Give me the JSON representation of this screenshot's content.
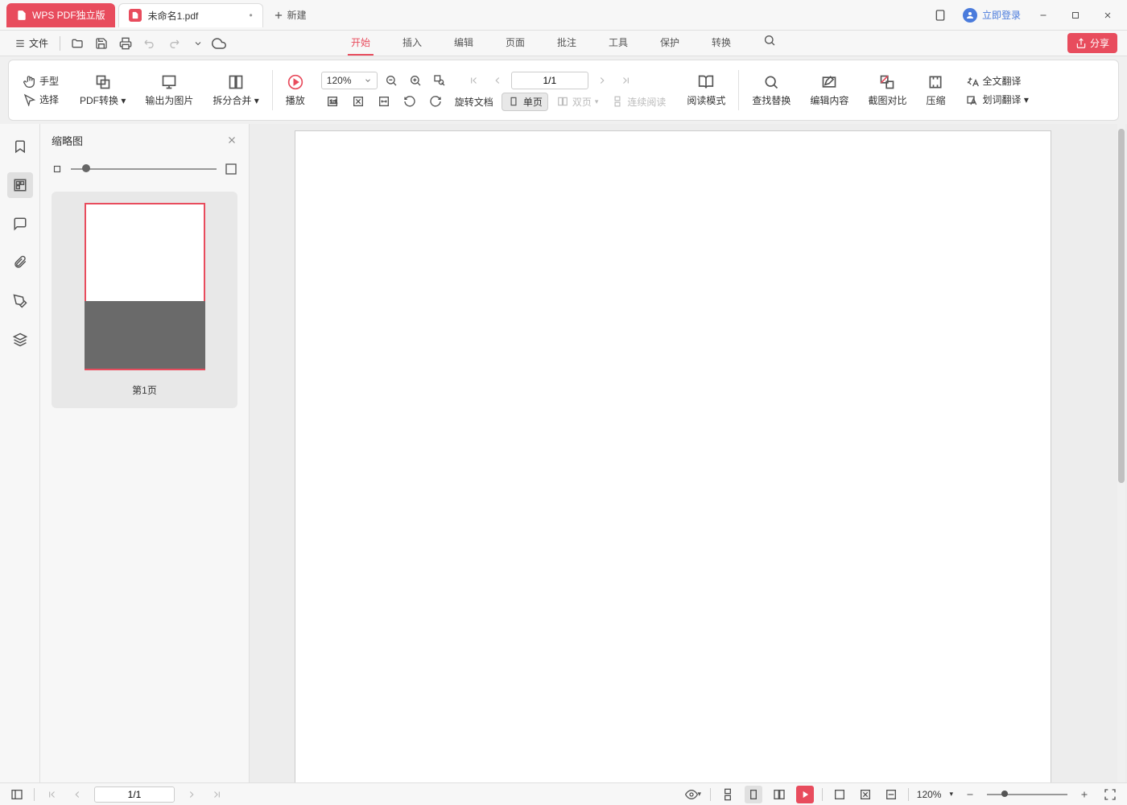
{
  "titleBar": {
    "appName": "WPS PDF独立版",
    "docName": "未命名1.pdf",
    "newTab": "新建",
    "login": "立即登录"
  },
  "quickBar": {
    "fileMenu": "文件"
  },
  "menuTabs": {
    "start": "开始",
    "insert": "插入",
    "edit": "编辑",
    "page": "页面",
    "annotate": "批注",
    "tools": "工具",
    "protect": "保护",
    "convert": "转换"
  },
  "ribbon": {
    "handTool": "手型",
    "selectTool": "选择",
    "pdfConvert": "PDF转换",
    "exportImage": "输出为图片",
    "splitMerge": "拆分合并",
    "play": "播放",
    "zoomValue": "120%",
    "pageIndicator": "1/1",
    "rotateDoc": "旋转文档",
    "singlePage": "单页",
    "doublePage": "双页",
    "continuousRead": "连续阅读",
    "readMode": "阅读模式",
    "findReplace": "查找替换",
    "editContent": "编辑内容",
    "screenshotCompare": "截图对比",
    "compress": "压缩",
    "fullTranslate": "全文翻译",
    "wordTranslate": "划词翻译"
  },
  "share": "分享",
  "thumbnail": {
    "title": "缩略图",
    "pageLabel": "第1页"
  },
  "statusBar": {
    "pageIndicator": "1/1",
    "zoomValue": "120%"
  }
}
